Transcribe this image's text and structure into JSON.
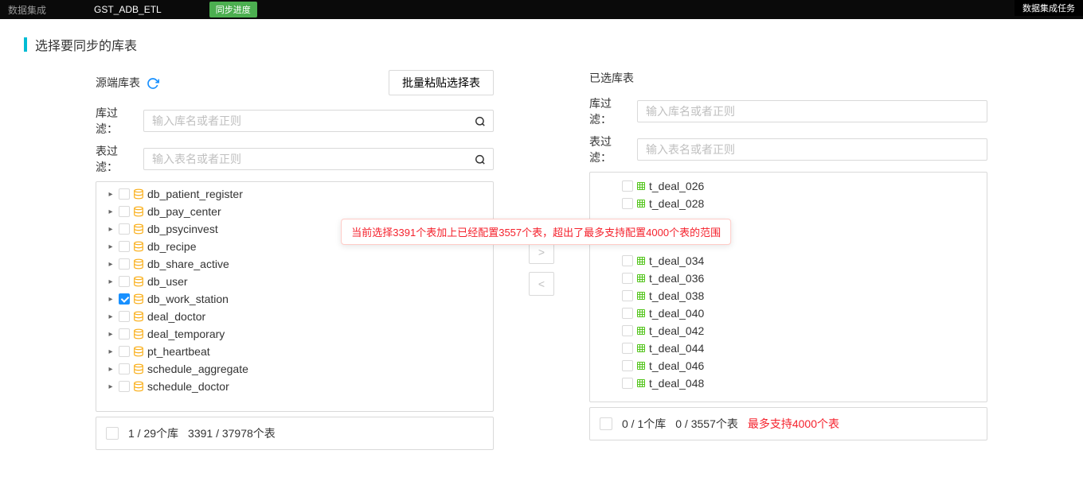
{
  "topBar": {
    "title": "数据集成",
    "tab": "GST_ADB_ETL",
    "badge": "同步进度",
    "right": "数据集成任务"
  },
  "section": {
    "title": "选择要同步的库表"
  },
  "sourcePanel": {
    "title": "源端库表",
    "batchBtn": "批量粘贴选择表",
    "dbFilterLabel": "库过滤：",
    "tableFilterLabel": "表过滤：",
    "filterPlaceholder1": "输入库名或者正则",
    "filterPlaceholder2": "输入表名或者正则",
    "summary1": "1 / 29个库",
    "summary2": "3391 / 37978个表",
    "items": [
      {
        "label": "db_patient_register",
        "checked": false
      },
      {
        "label": "db_pay_center",
        "checked": false
      },
      {
        "label": "db_psycinvest",
        "checked": false
      },
      {
        "label": "db_recipe",
        "checked": false
      },
      {
        "label": "db_share_active",
        "checked": false
      },
      {
        "label": "db_user",
        "checked": false
      },
      {
        "label": "db_work_station",
        "checked": true
      },
      {
        "label": "deal_doctor",
        "checked": false
      },
      {
        "label": "deal_temporary",
        "checked": false
      },
      {
        "label": "pt_heartbeat",
        "checked": false
      },
      {
        "label": "schedule_aggregate",
        "checked": false
      },
      {
        "label": "schedule_doctor",
        "checked": false
      }
    ]
  },
  "destPanel": {
    "title": "已选库表",
    "dbFilterLabel": "库过滤：",
    "tableFilterLabel": "表过滤：",
    "filterPlaceholder1": "输入库名或者正则",
    "filterPlaceholder2": "输入表名或者正则",
    "summary1": "0 / 1个库",
    "summary2": "0 / 3557个表",
    "summaryWarn": "最多支持4000个表",
    "items": [
      {
        "label": "t_deal_026"
      },
      {
        "label": "t_deal_028"
      },
      {
        "label": "t_deal_034"
      },
      {
        "label": "t_deal_036"
      },
      {
        "label": "t_deal_038"
      },
      {
        "label": "t_deal_040"
      },
      {
        "label": "t_deal_042"
      },
      {
        "label": "t_deal_044"
      },
      {
        "label": "t_deal_046"
      },
      {
        "label": "t_deal_048"
      }
    ]
  },
  "alert": "当前选择3391个表加上已经配置3557个表，超出了最多支持配置4000个表的范围",
  "transferBtns": {
    "right": ">",
    "left": "<"
  }
}
